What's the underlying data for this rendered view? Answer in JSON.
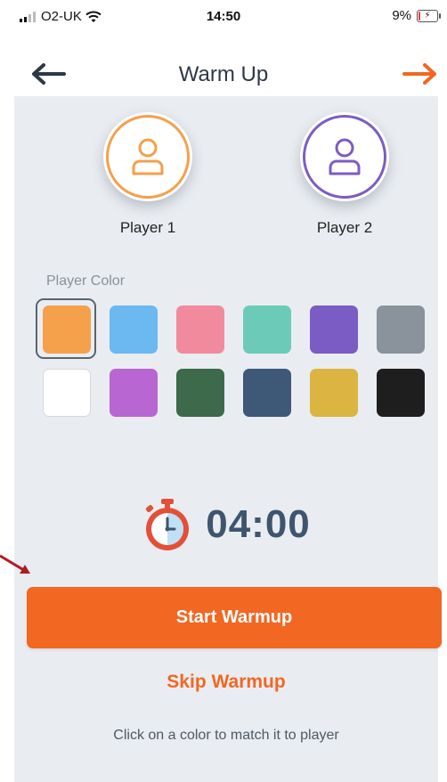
{
  "status_bar": {
    "carrier": "O2-UK",
    "time": "14:50",
    "battery": "9%",
    "battery_level": 0.09
  },
  "header": {
    "title": "Warm Up",
    "back_icon": "arrow-left-icon",
    "next_icon": "arrow-right-icon"
  },
  "players": [
    {
      "name": "Player 1",
      "color": "#f5a04a",
      "icon": "user-icon"
    },
    {
      "name": "Player 2",
      "color": "#7c5cc4",
      "icon": "user-icon"
    }
  ],
  "color_picker": {
    "label": "Player Color",
    "selected_index": 0,
    "colors": [
      "#f5a04a",
      "#6cb8f0",
      "#f28a9e",
      "#6ccbb8",
      "#7a5cc4",
      "#8a939c",
      "#ffffff",
      "#b866d2",
      "#3c6a4a",
      "#3e5878",
      "#dbb442",
      "#1e1e1e"
    ]
  },
  "timer": {
    "value": "04:00",
    "icon": "stopwatch-icon"
  },
  "actions": {
    "start_label": "Start Warmup",
    "skip_label": "Skip Warmup"
  },
  "hint": "Click on a color to match it to player",
  "colors": {
    "accent": "#f26722",
    "panel_bg": "#e9edf1",
    "title_text": "#2c3846"
  }
}
